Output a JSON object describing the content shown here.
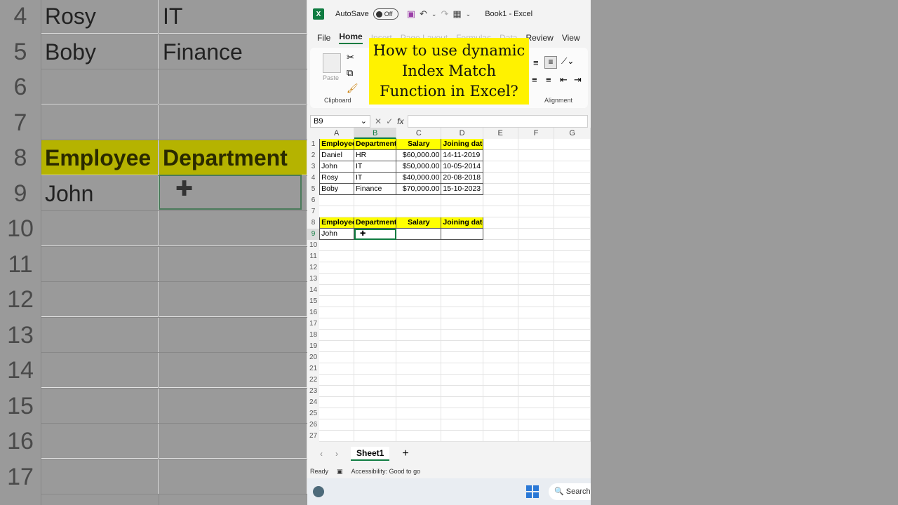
{
  "background_zoom": {
    "rows": [
      {
        "num": "4",
        "a": "Rosy",
        "b": "IT"
      },
      {
        "num": "5",
        "a": "Boby",
        "b": "Finance"
      },
      {
        "num": "6",
        "a": "",
        "b": ""
      },
      {
        "num": "7",
        "a": "",
        "b": ""
      },
      {
        "num": "8",
        "a": "Employee",
        "b": "Department"
      },
      {
        "num": "9",
        "a": "John",
        "b": ""
      },
      {
        "num": "10",
        "a": "",
        "b": ""
      },
      {
        "num": "11",
        "a": "",
        "b": ""
      },
      {
        "num": "12",
        "a": "",
        "b": ""
      },
      {
        "num": "13",
        "a": "",
        "b": ""
      },
      {
        "num": "14",
        "a": "",
        "b": ""
      },
      {
        "num": "15",
        "a": "",
        "b": ""
      },
      {
        "num": "16",
        "a": "",
        "b": ""
      },
      {
        "num": "17",
        "a": "",
        "b": ""
      }
    ]
  },
  "titlebar": {
    "autosave_label": "AutoSave",
    "toggle_state": "Off",
    "doc_title": "Book1  -  Excel"
  },
  "menu": [
    "File",
    "Home",
    "Insert",
    "Page Layout",
    "Formulas",
    "Data",
    "Review",
    "View"
  ],
  "ribbon": {
    "paste_label": "Paste",
    "clipboard_label": "Clipboard",
    "alignment_label": "Alignment"
  },
  "overlay_title": "How to use dynamic Index Match Function in Excel?",
  "formula_bar": {
    "name_box": "B9",
    "fx": "fx"
  },
  "grid": {
    "columns": [
      "A",
      "B",
      "C",
      "D",
      "E",
      "F",
      "G"
    ],
    "selected_column": "B",
    "selected_row": "9",
    "rows": [
      {
        "n": "1",
        "cells": [
          "Employee",
          "Department",
          "Salary",
          "Joining date"
        ],
        "type": "header"
      },
      {
        "n": "2",
        "cells": [
          "Daniel",
          "HR",
          "$60,000.00",
          "14-11-2019"
        ],
        "type": "data"
      },
      {
        "n": "3",
        "cells": [
          "John",
          "IT",
          "$50,000.00",
          "10-05-2014"
        ],
        "type": "data"
      },
      {
        "n": "4",
        "cells": [
          "Rosy",
          "IT",
          "$40,000.00",
          "20-08-2018"
        ],
        "type": "data"
      },
      {
        "n": "5",
        "cells": [
          "Boby",
          "Finance",
          "$70,000.00",
          "15-10-2023"
        ],
        "type": "data"
      },
      {
        "n": "6",
        "cells": [
          "",
          "",
          "",
          ""
        ],
        "type": "empty"
      },
      {
        "n": "7",
        "cells": [
          "",
          "",
          "",
          ""
        ],
        "type": "empty"
      },
      {
        "n": "8",
        "cells": [
          "Employee",
          "Department",
          "Salary",
          "Joining date"
        ],
        "type": "header"
      },
      {
        "n": "9",
        "cells": [
          "John",
          "",
          "",
          ""
        ],
        "type": "data"
      },
      {
        "n": "10",
        "cells": [
          "",
          "",
          "",
          ""
        ],
        "type": "empty"
      },
      {
        "n": "11",
        "cells": [
          "",
          "",
          "",
          ""
        ],
        "type": "empty"
      },
      {
        "n": "12",
        "cells": [
          "",
          "",
          "",
          ""
        ],
        "type": "empty"
      },
      {
        "n": "13",
        "cells": [
          "",
          "",
          "",
          ""
        ],
        "type": "empty"
      },
      {
        "n": "14",
        "cells": [
          "",
          "",
          "",
          ""
        ],
        "type": "empty"
      },
      {
        "n": "15",
        "cells": [
          "",
          "",
          "",
          ""
        ],
        "type": "empty"
      },
      {
        "n": "16",
        "cells": [
          "",
          "",
          "",
          ""
        ],
        "type": "empty"
      },
      {
        "n": "17",
        "cells": [
          "",
          "",
          "",
          ""
        ],
        "type": "empty"
      },
      {
        "n": "18",
        "cells": [
          "",
          "",
          "",
          ""
        ],
        "type": "empty"
      },
      {
        "n": "19",
        "cells": [
          "",
          "",
          "",
          ""
        ],
        "type": "empty"
      },
      {
        "n": "20",
        "cells": [
          "",
          "",
          "",
          ""
        ],
        "type": "empty"
      },
      {
        "n": "21",
        "cells": [
          "",
          "",
          "",
          ""
        ],
        "type": "empty"
      },
      {
        "n": "22",
        "cells": [
          "",
          "",
          "",
          ""
        ],
        "type": "empty"
      },
      {
        "n": "23",
        "cells": [
          "",
          "",
          "",
          ""
        ],
        "type": "empty"
      },
      {
        "n": "24",
        "cells": [
          "",
          "",
          "",
          ""
        ],
        "type": "empty"
      },
      {
        "n": "25",
        "cells": [
          "",
          "",
          "",
          ""
        ],
        "type": "empty"
      },
      {
        "n": "26",
        "cells": [
          "",
          "",
          "",
          ""
        ],
        "type": "empty"
      },
      {
        "n": "27",
        "cells": [
          "",
          "",
          "",
          ""
        ],
        "type": "empty"
      }
    ]
  },
  "sheet_tab": "Sheet1",
  "status": {
    "ready": "Ready",
    "accessibility": "Accessibility: Good to go"
  },
  "taskbar": {
    "search": "Search"
  },
  "colors": {
    "excel_green": "#107c41",
    "header_yellow": "#ffff00",
    "overlay_yellow": "#fff200"
  }
}
